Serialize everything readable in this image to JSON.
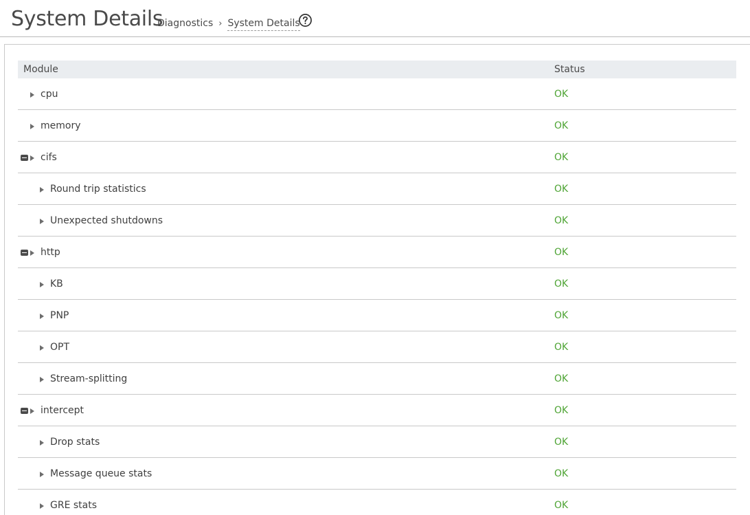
{
  "header": {
    "title": "System Details",
    "breadcrumb": {
      "parent": "Diagnostics",
      "separator": "›",
      "current": "System Details"
    },
    "help_icon": "question-circle-icon"
  },
  "table": {
    "columns": {
      "module": "Module",
      "status": "Status"
    },
    "rows": [
      {
        "label": "cpu",
        "status": "OK",
        "level": 0,
        "expanded": false
      },
      {
        "label": "memory",
        "status": "OK",
        "level": 0,
        "expanded": false
      },
      {
        "label": "cifs",
        "status": "OK",
        "level": 0,
        "expanded": true
      },
      {
        "label": "Round trip statistics",
        "status": "OK",
        "level": 1,
        "expanded": false
      },
      {
        "label": "Unexpected shutdowns",
        "status": "OK",
        "level": 1,
        "expanded": false
      },
      {
        "label": "http",
        "status": "OK",
        "level": 0,
        "expanded": true
      },
      {
        "label": "KB",
        "status": "OK",
        "level": 1,
        "expanded": false
      },
      {
        "label": "PNP",
        "status": "OK",
        "level": 1,
        "expanded": false
      },
      {
        "label": "OPT",
        "status": "OK",
        "level": 1,
        "expanded": false
      },
      {
        "label": "Stream-splitting",
        "status": "OK",
        "level": 1,
        "expanded": false
      },
      {
        "label": "intercept",
        "status": "OK",
        "level": 0,
        "expanded": true
      },
      {
        "label": "Drop stats",
        "status": "OK",
        "level": 1,
        "expanded": false
      },
      {
        "label": "Message queue stats",
        "status": "OK",
        "level": 1,
        "expanded": false
      },
      {
        "label": "GRE stats",
        "status": "OK",
        "level": 1,
        "expanded": false
      }
    ]
  },
  "colors": {
    "status_ok": "#4ea434",
    "header_bg": "#eaedf0"
  }
}
